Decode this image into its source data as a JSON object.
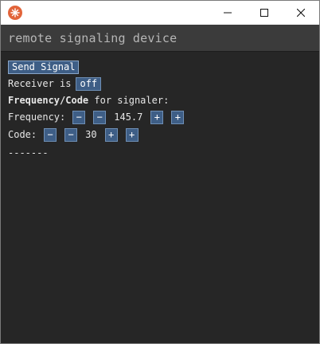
{
  "window": {
    "icon": "app-logo-icon",
    "controls": [
      "minimize-icon",
      "maximize-icon",
      "close-icon"
    ]
  },
  "header": {
    "title": "remote signaling device"
  },
  "main": {
    "send_button_label": "Send Signal",
    "receiver_text": "Receiver is",
    "receiver_state": "off",
    "section_label_bold": "Frequency/Code",
    "section_label_rest": " for signaler:",
    "frequency": {
      "label": "Frequency:",
      "value": "145.7",
      "minus": "−",
      "plus": "+"
    },
    "code": {
      "label": "Code:",
      "value": "30",
      "minus": "−",
      "plus": "+"
    },
    "output": "-------"
  },
  "colors": {
    "background": "#262626",
    "header_bg": "#3b3b3b",
    "button_bg": "#3e5e86",
    "icon_accent": "#e2643a"
  }
}
